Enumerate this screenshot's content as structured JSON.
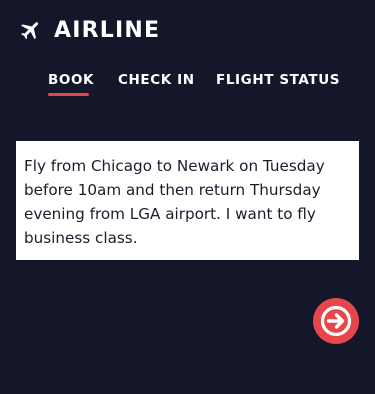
{
  "header": {
    "logo_icon": "airplane-icon",
    "brand": "AIRLINE"
  },
  "tabs": [
    {
      "label": "BOOK",
      "active": true
    },
    {
      "label": "CHECK IN",
      "active": false
    },
    {
      "label": "FLIGHT STATUS",
      "active": false
    }
  ],
  "query": {
    "text": "Fly from Chicago to Newark on Tuesday before 10am and then return Thursday evening from LGA airport. I want to fly business class."
  },
  "submit": {
    "icon": "arrow-right-icon"
  },
  "colors": {
    "background": "#141629",
    "accent": "#e5474b",
    "text": "#ffffff",
    "box": "#ffffff",
    "box_text": "#1c1d2b"
  }
}
